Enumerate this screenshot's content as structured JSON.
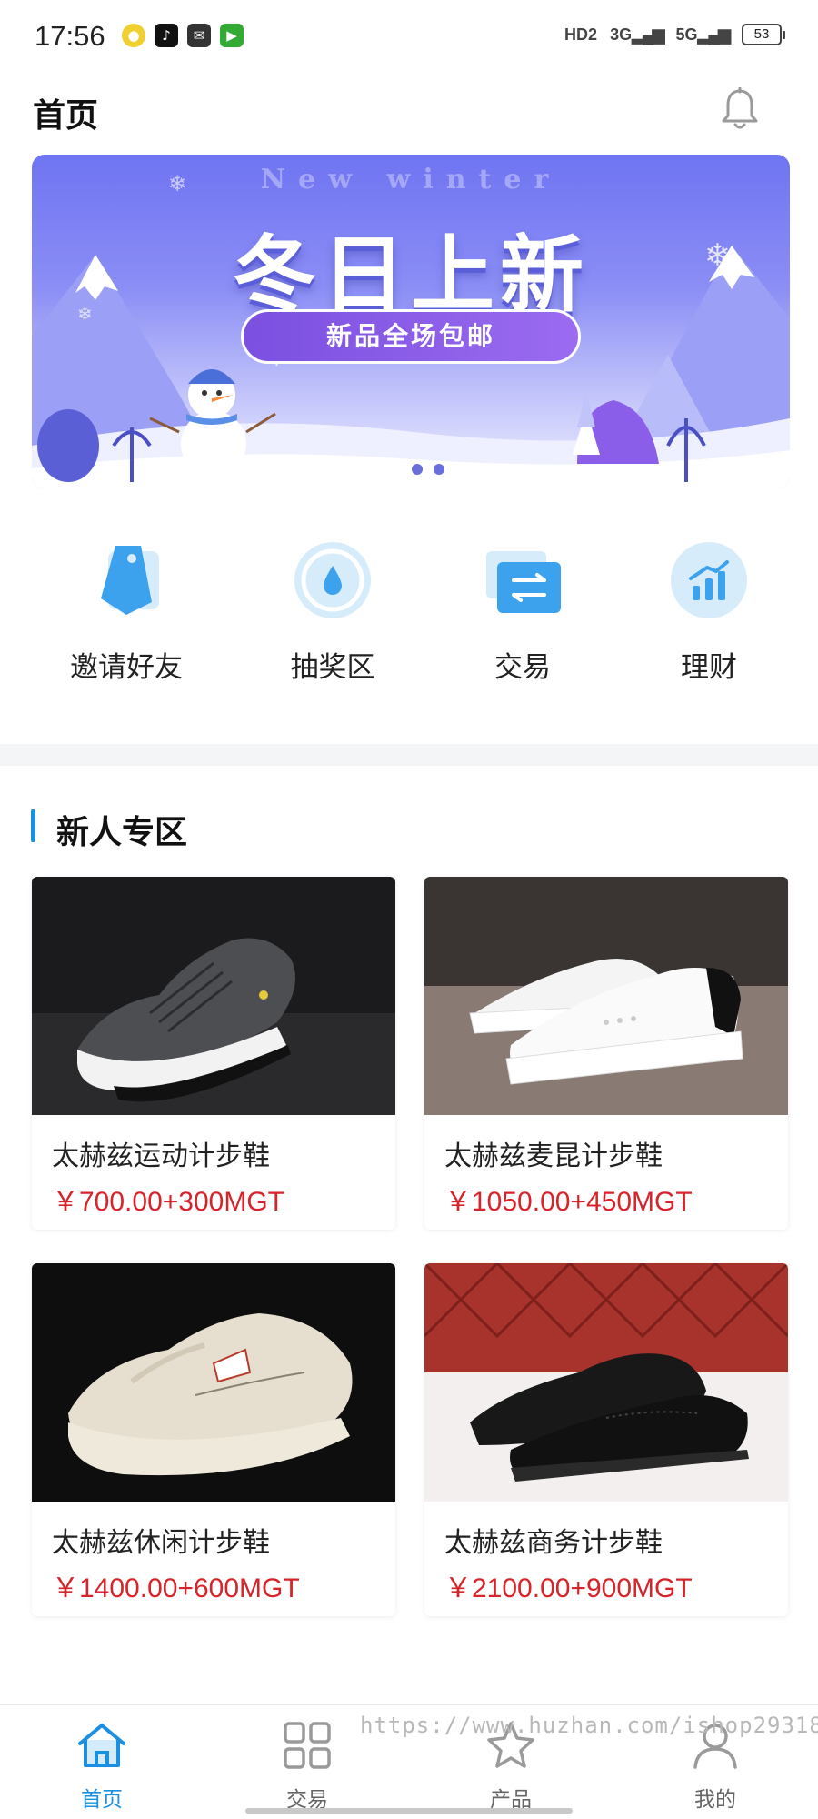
{
  "status_bar": {
    "time": "17:56",
    "signal_hd": "HD2",
    "signal_3g": "3G",
    "signal_5g": "5G",
    "battery": "53"
  },
  "header": {
    "title": "首页",
    "notification_icon": "bell-icon"
  },
  "banner": {
    "subtitle": "New winter",
    "title": "冬日上新",
    "pill_text": "新品全场包邮",
    "slide_count": 2,
    "active_slide": 1,
    "colors": {
      "sky": "#7377f3",
      "pill": "#8a5ee8",
      "dot_active": "#ffffff",
      "dot_inactive": "#6a6ed6"
    }
  },
  "quick_menu": [
    {
      "label": "邀请好友",
      "icon": "tag-icon"
    },
    {
      "label": "抽奖区",
      "icon": "drop-icon"
    },
    {
      "label": "交易",
      "icon": "swap-icon"
    },
    {
      "label": "理财",
      "icon": "chart-icon"
    }
  ],
  "section": {
    "title": "新人专区",
    "accent": "#1b8fe0"
  },
  "products": [
    {
      "name": "太赫兹运动计步鞋",
      "price": "￥700.00+300MGT",
      "image": "grey-knit-sneaker"
    },
    {
      "name": "太赫兹麦昆计步鞋",
      "price": "￥1050.00+450MGT",
      "image": "white-platform-sneaker"
    },
    {
      "name": "太赫兹休闲计步鞋",
      "price": "￥1400.00+600MGT",
      "image": "beige-chunky-sneaker"
    },
    {
      "name": "太赫兹商务计步鞋",
      "price": "￥2100.00+900MGT",
      "image": "black-leather-brogue"
    }
  ],
  "bottom_nav": [
    {
      "label": "首页",
      "icon": "home-icon",
      "active": true
    },
    {
      "label": "交易",
      "icon": "grid-icon",
      "active": false
    },
    {
      "label": "产品",
      "icon": "star-icon",
      "active": false
    },
    {
      "label": "我的",
      "icon": "user-icon",
      "active": false
    }
  ],
  "watermark": "https://www.huzhan.com/ishop29318",
  "colors": {
    "accent": "#1b8fe0",
    "price": "#d8232a"
  }
}
